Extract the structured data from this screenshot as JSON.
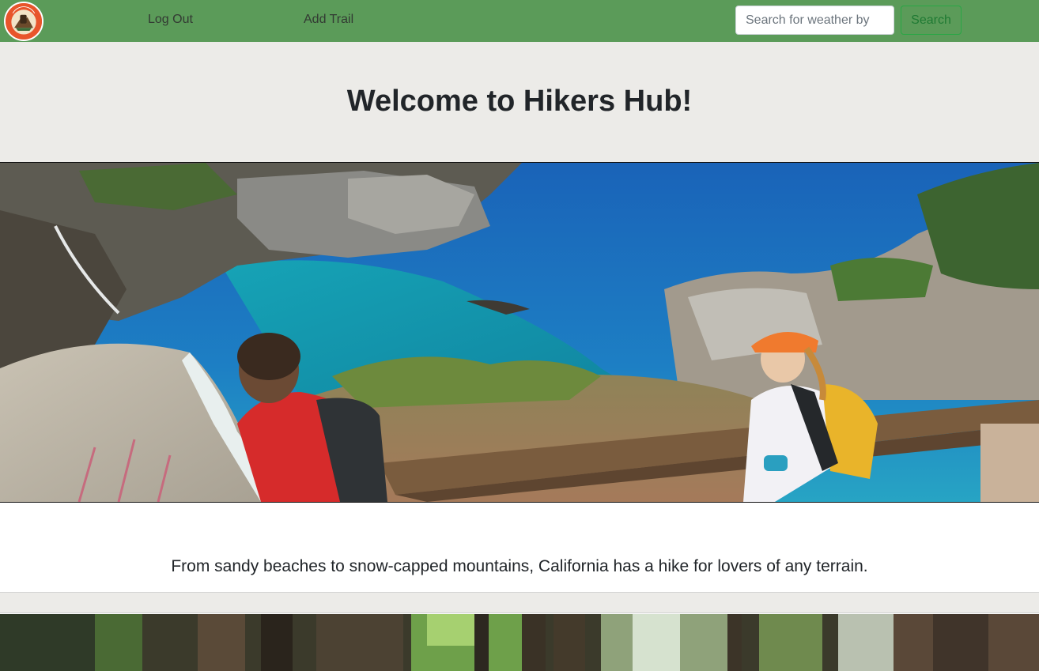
{
  "nav": {
    "logo_text": "HIKERS HUB",
    "links": [
      {
        "label": "Log Out"
      },
      {
        "label": "Add Trail"
      }
    ],
    "search": {
      "placeholder": "Search for weather by",
      "button_label": "Search"
    }
  },
  "hero": {
    "title": "Welcome to Hikers Hub!",
    "image_icon": "coastal-hikers-photo"
  },
  "tagline": "From sandy beaches to snow-capped mountains, California has a hike for lovers of any terrain.",
  "forest": {
    "image_icon": "forest-photo"
  },
  "colors": {
    "nav_bg": "#5b9b59",
    "band_bg": "#ecebe8",
    "search_accent": "#28a745",
    "logo": "#e8552b"
  }
}
